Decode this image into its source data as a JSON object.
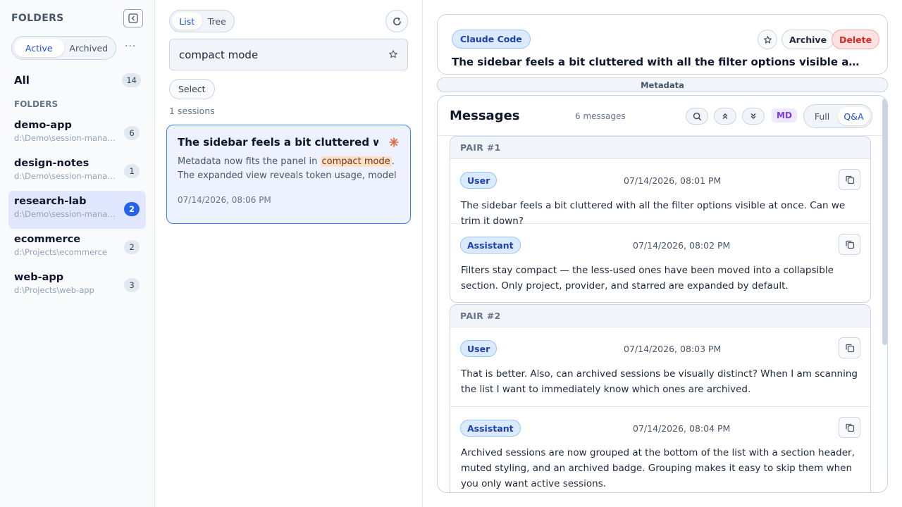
{
  "sidebar": {
    "header": "FOLDERS",
    "tabs": [
      {
        "label": "Active"
      },
      {
        "label": "Archived"
      }
    ],
    "more": "···",
    "all": {
      "label": "All",
      "count": "14"
    },
    "section_label": "FOLDERS",
    "folders": [
      {
        "name": "demo-app",
        "path": "d:\\Demo\\session-manager\\demo-app",
        "count": "6"
      },
      {
        "name": "design-notes",
        "path": "d:\\Demo\\session-manager\\design-notes",
        "count": "1"
      },
      {
        "name": "research-lab",
        "path": "d:\\Demo\\session-manager\\research-lab",
        "count": "2"
      },
      {
        "name": "ecommerce",
        "path": "d:\\Projects\\ecommerce",
        "count": "2"
      },
      {
        "name": "web-app",
        "path": "d:\\Projects\\web-app",
        "count": "3"
      }
    ]
  },
  "middle": {
    "view_tabs": [
      {
        "label": "List"
      },
      {
        "label": "Tree"
      }
    ],
    "search": {
      "value": "compact mode"
    },
    "select_label": "Select",
    "sessions_count": "1 sessions",
    "session": {
      "title": "The sidebar feels a bit cluttered with all the filter options visible at once. Can we trim it down?",
      "snippet_before": "Metadata now fits the panel in ",
      "snippet_highlight": "compact mode",
      "snippet_after": ". The expanded view reveals token usage, model name, and other details when needed.",
      "time": "07/14/2026, 08:06 PM"
    }
  },
  "detail": {
    "provider": "Claude Code",
    "archive_label": "Archive",
    "delete_label": "Delete",
    "title": "The sidebar feels a bit cluttered with all the filter options visible at once. Can we trim it down?",
    "metadata_label": "Metadata",
    "messages_title": "Messages",
    "messages_count": "6 messages",
    "md_label": "MD",
    "mode_tabs": [
      {
        "label": "Full"
      },
      {
        "label": "Q&A"
      }
    ],
    "pairs": [
      {
        "label": "PAIR #1",
        "messages": [
          {
            "role": "User",
            "time": "07/14/2026, 08:01 PM",
            "text": "The sidebar feels a bit cluttered with all the filter options visible at once. Can we trim it down?"
          },
          {
            "role": "Assistant",
            "time": "07/14/2026, 08:02 PM",
            "text": "Filters stay compact — the less-used ones have been moved into a collapsible section. Only project, provider, and starred are expanded by default."
          }
        ]
      },
      {
        "label": "PAIR #2",
        "messages": [
          {
            "role": "User",
            "time": "07/14/2026, 08:03 PM",
            "text": "That is better. Also, can archived sessions be visually distinct? When I am scanning the list I want to immediately know which ones are archived."
          },
          {
            "role": "Assistant",
            "time": "07/14/2026, 08:04 PM",
            "text": "Archived sessions are now grouped at the bottom of the list with a section header, muted styling, and an archived badge. Grouping makes it easy to skip them when you only want active sessions."
          }
        ]
      }
    ]
  },
  "colors": {
    "accent": "#2563eb",
    "danger": "#dc2626",
    "highlight": "#fde2c8"
  }
}
